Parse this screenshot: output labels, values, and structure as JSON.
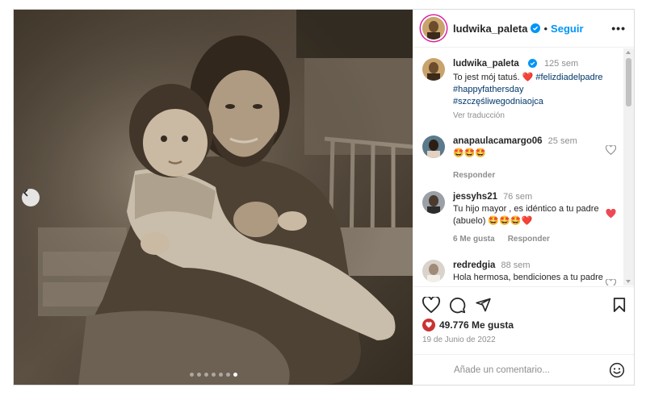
{
  "post": {
    "username": "ludwika_paleta",
    "follow_label": "Seguir",
    "more_label": "•••",
    "separator": "•",
    "caption": {
      "username": "ludwika_paleta",
      "time": "125 sem",
      "text": "To jest mój tatuś. ",
      "heart": "❤️",
      "hashtags": [
        "#felizdiadelpadre",
        "#happyfathersday",
        "#szczęśliwegodniaojca"
      ],
      "translate_label": "Ver traducción"
    },
    "comments": [
      {
        "username": "anapaulacamargo06",
        "time": "25 sem",
        "text": "🤩🤩🤩",
        "likes_label": "",
        "reply_label": "Responder",
        "liked": false
      },
      {
        "username": "jessyhs21",
        "time": "76 sem",
        "text": "Tu hijo mayor , es idéntico a tu padre (abuelo) 🤩🤩🤩❤️",
        "likes_label": "6 Me gusta",
        "reply_label": "Responder",
        "liked": true
      },
      {
        "username": "redredgia",
        "time": "88 sem",
        "text": "Hola hermosa, bendiciones a tu padre y bella familia. Tu fan desde",
        "likes_label": "",
        "reply_label": "",
        "liked": false
      }
    ],
    "likes": "49.776 Me gusta",
    "date": "19 de Junio de 2022",
    "add_comment_placeholder": "Añade un comentario...",
    "carousel": {
      "total": 7,
      "active": 6
    }
  },
  "colors": {
    "accent": "#0095f6",
    "liked": "#ed4956",
    "hashtag": "#00376b",
    "muted": "#8e8e8e"
  },
  "icons": [
    "verified-icon",
    "more-options-icon",
    "heart-icon",
    "comment-icon",
    "share-icon",
    "save-icon",
    "emoji-icon",
    "chevron-left-icon"
  ]
}
